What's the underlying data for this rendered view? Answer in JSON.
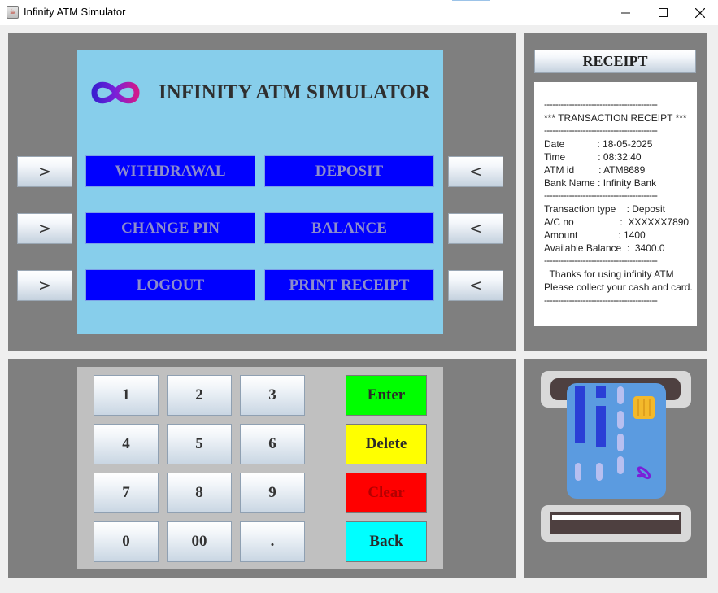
{
  "window": {
    "title": "Infinity ATM Simulator",
    "app_icon_glyph": "☕",
    "controls": {
      "minimize": "minimize-icon",
      "maximize": "maximize-icon",
      "close": "close-icon"
    }
  },
  "screen": {
    "title": "INFINITY ATM SIMULATOR",
    "logo": "infinity-logo-icon",
    "menu": {
      "withdrawal": "WITHDRAWAL",
      "deposit": "DEPOSIT",
      "change_pin": "CHANGE PIN",
      "balance": "BALANCE",
      "logout": "LOGOUT",
      "print_receipt": "PRINT RECEIPT"
    }
  },
  "side_buttons": {
    "left": ">",
    "right": "<"
  },
  "receipt": {
    "header": "RECEIPT",
    "lines": {
      "sep": "-----------------------------------------",
      "heading": "*** TRANSACTION RECEIPT ***",
      "date": "Date            : 18-05-2025",
      "time": "Time            : 08:32:40",
      "atm_id": "ATM id         : ATM8689",
      "bank": "Bank Name : Infinity Bank",
      "txn_type": "Transaction type    : Deposit",
      "ac_no": "A/C no                 :  XXXXXX7890",
      "amount": "Amount               : 1400",
      "available": "Available Balance  :  3400.0",
      "thanks": "  Thanks for using infinity ATM",
      "collect": "Please collect your cash and card."
    }
  },
  "keypad": {
    "keys": {
      "k1": "1",
      "k2": "2",
      "k3": "3",
      "k4": "4",
      "k5": "5",
      "k6": "6",
      "k7": "7",
      "k8": "8",
      "k9": "9",
      "k0": "0",
      "k00": "00",
      "kdot": "."
    },
    "actions": {
      "enter": "Enter",
      "delete": "Delete",
      "clear": "Clear",
      "back": "Back"
    }
  },
  "colors": {
    "panel": "#7f7f7f",
    "screen": "#87ceeb",
    "menu_button": "#0000ff",
    "keypad_bg": "#c0c0c0",
    "enter": "#00ff00",
    "delete": "#ffff00",
    "clear": "#ff0000",
    "back": "#00ffff",
    "card": "#5b9be0"
  }
}
